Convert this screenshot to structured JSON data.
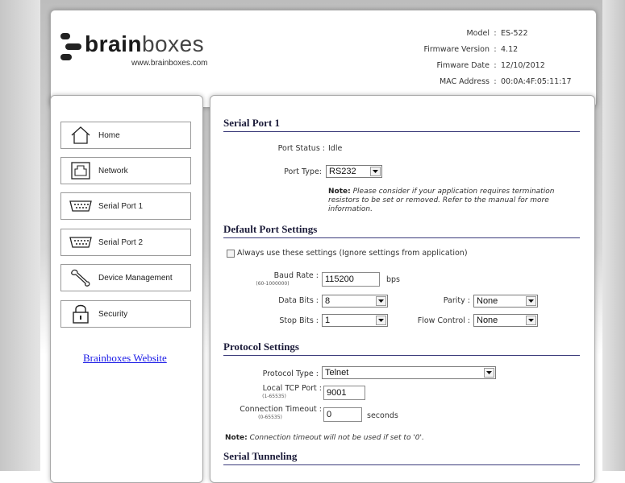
{
  "header": {
    "logo": {
      "brand_bold": "brain",
      "brand_light": "boxes",
      "url": "www.brainboxes.com"
    },
    "info": [
      {
        "key": "Model",
        "value": "ES-522"
      },
      {
        "key": "Firmware Version",
        "value": "4.12"
      },
      {
        "key": "Fimware Date",
        "value": "12/10/2012"
      },
      {
        "key": "MAC Address",
        "value": "00:0A:4F:05:11:17"
      }
    ]
  },
  "sidebar": {
    "items": [
      {
        "label": "Home",
        "icon": "home-icon"
      },
      {
        "label": "Network",
        "icon": "network-icon"
      },
      {
        "label": "Serial Port 1",
        "icon": "serial-port-icon"
      },
      {
        "label": "Serial Port 2",
        "icon": "serial-port-icon"
      },
      {
        "label": "Device Management",
        "icon": "wrench-icon"
      },
      {
        "label": "Security",
        "icon": "padlock-icon"
      }
    ],
    "website_link": "Brainboxes Website"
  },
  "serial_port": {
    "title": "Serial Port 1",
    "port_status_label": "Port Status :",
    "port_status_value": "Idle",
    "port_type_label": "Port Type:",
    "port_type_value": "RS232",
    "note_bold": "Note:",
    "note_text": "Please consider if your application requires termination resistors to be set or removed. Refer to the manual for more information."
  },
  "default_port": {
    "title": "Default Port Settings",
    "always_use_label": "Always use these settings (Ignore settings from application)",
    "always_use_checked": false,
    "baud_label": "Baud Rate :",
    "baud_range": "(60-1000000)",
    "baud_value": "115200",
    "baud_unit": "bps",
    "data_bits_label": "Data Bits :",
    "data_bits_value": "8",
    "parity_label": "Parity :",
    "parity_value": "None",
    "stop_bits_label": "Stop Bits :",
    "stop_bits_value": "1",
    "flow_control_label": "Flow Control :",
    "flow_control_value": "None"
  },
  "protocol": {
    "title": "Protocol Settings",
    "protocol_type_label": "Protocol Type :",
    "protocol_type_value": "Telnet",
    "local_port_label": "Local TCP Port :",
    "local_port_range": "(1-65535)",
    "local_port_value": "9001",
    "timeout_label": "Connection Timeout :",
    "timeout_range": "(0-65535)",
    "timeout_value": "0",
    "timeout_unit": "seconds",
    "note_bold": "Note:",
    "note_text": "Connection timeout will not be used if set to '0'."
  },
  "tunneling": {
    "title": "Serial Tunneling"
  },
  "colors": {
    "heading": "#1c1c3a",
    "rule": "#3a3a7a",
    "link": "#1a1ae6",
    "panel_border": "#a9a9a9"
  }
}
